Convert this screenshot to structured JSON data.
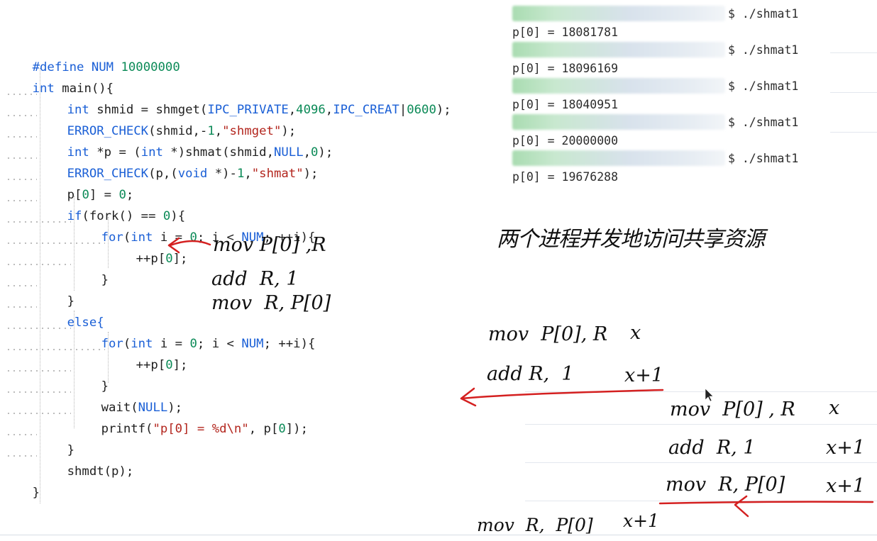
{
  "code": {
    "lines": [
      "#define NUM 10000000",
      "int main(){",
      "int shmid = shmget(IPC_PRIVATE,4096,IPC_CREAT|0600);",
      "ERROR_CHECK(shmid,-1,\"shmget\");",
      "int *p = (int *)shmat(shmid,NULL,0);",
      "ERROR_CHECK(p,(void *)-1,\"shmat\");",
      "p[0] = 0;",
      "if(fork() == 0){",
      "for(int i = 0; i < NUM; ++i){",
      "++p[0];",
      "}",
      "}",
      "else{",
      "for(int i = 0; i < NUM; ++i){",
      "++p[0];",
      "}",
      "wait(NULL);",
      "printf(\"p[0] = %d\\n\", p[0]);",
      "}",
      "shmdt(p);",
      "}"
    ]
  },
  "terminal": {
    "command": "$ ./shmat1",
    "outputs": [
      "p[0] = 18081781",
      "p[0] = 18096169",
      "p[0] = 18040951",
      "p[0] = 20000000",
      "p[0] = 19676288"
    ]
  },
  "annotations": {
    "title": "两个进程并发地访问共享资源",
    "asm_top": [
      "mov P[0] ,R",
      "add  R, 1",
      "mov  R, P[0]"
    ],
    "seq1": [
      {
        "instr": "mov  P[0], R",
        "val": "x"
      },
      {
        "instr": "add R,  1",
        "val": "x+1"
      }
    ],
    "seq2": [
      {
        "instr": "mov  P[0] , R",
        "val": "x"
      },
      {
        "instr": "add  R, 1",
        "val": "x+1"
      },
      {
        "instr": "mov  R, P[0]",
        "val": "x+1"
      }
    ],
    "bottom": {
      "instr": "mov  R,  P[0]",
      "val": "x+1"
    }
  },
  "colors": {
    "keyword": "#1a5fd6",
    "number": "#0b8a57",
    "string": "#b3261e",
    "ink_red": "#d42020"
  }
}
